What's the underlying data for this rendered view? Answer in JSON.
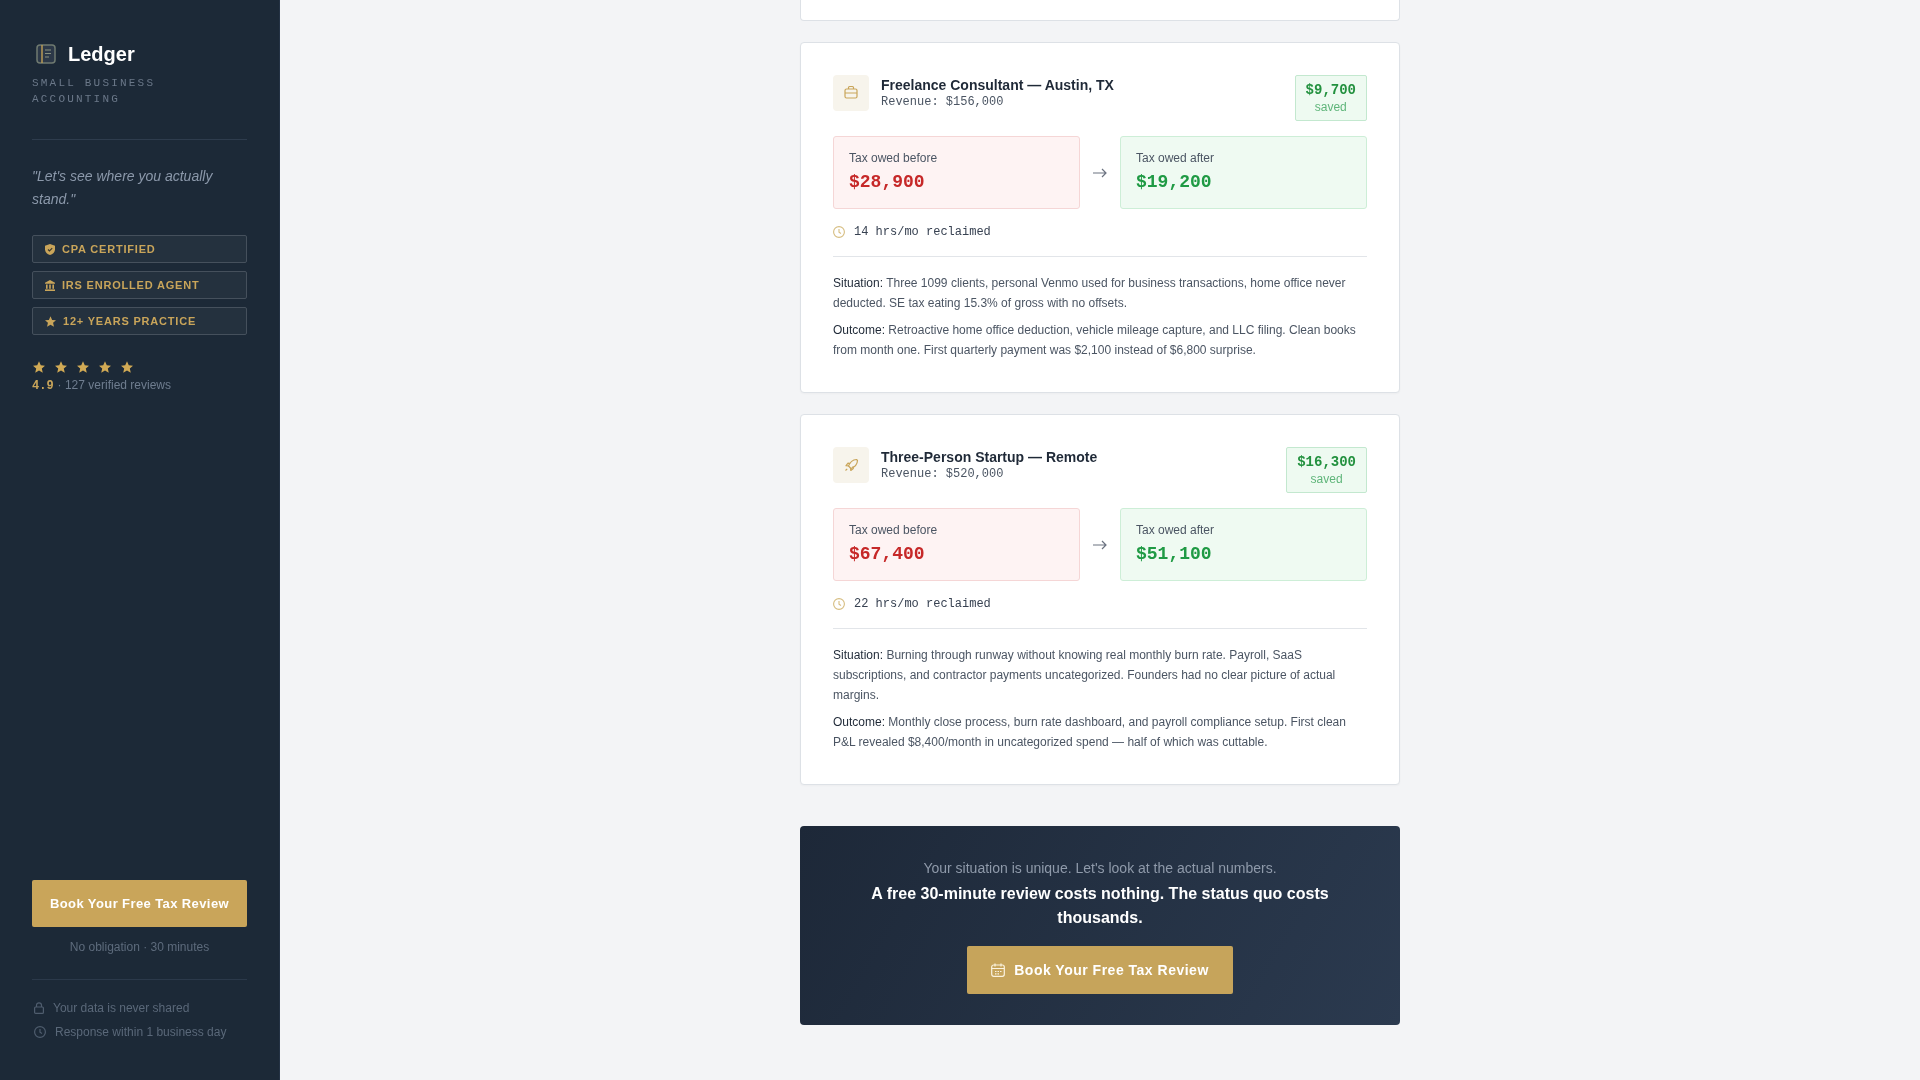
{
  "sidebar": {
    "brand": {
      "name": "Ledger",
      "tagline": "SMALL BUSINESS ACCOUNTING"
    },
    "quote": "\"Let's see where you actually stand.\"",
    "credentials": [
      {
        "kind": "shield",
        "label": "CPA CERTIFIED"
      },
      {
        "kind": "bank",
        "label": "IRS ENROLLED AGENT"
      },
      {
        "kind": "star",
        "label": "12+ YEARS PRACTICE"
      }
    ],
    "rating": {
      "stars": 5,
      "score": "4.9",
      "reviews": "· 127 verified reviews"
    },
    "button": "Book Your Free Tax Review",
    "note": "No obligation · 30 minutes",
    "trust": [
      {
        "kind": "lock",
        "text": "Your data is never shared"
      },
      {
        "kind": "clock",
        "text": "Response within 1 business day"
      }
    ]
  },
  "case_studies": [
    {
      "kind": "briefcase",
      "title": "Freelance Consultant — Austin, TX",
      "revenue": "Revenue: $156,000",
      "saved": "$9,700",
      "saved_label": "saved",
      "before_label": "Tax owed before",
      "before": "$28,900",
      "after_label": "Tax owed after",
      "after": "$19,200",
      "hours": "14 hrs/mo reclaimed",
      "notes": [
        {
          "label": "Situation:",
          "text": "Three 1099 clients, personal Venmo used for business transactions, home office never deducted. SE tax eating 15.3% of gross with no offsets."
        },
        {
          "label": "Outcome:",
          "text": "Retroactive home office deduction, vehicle mileage capture, and LLC filing. Clean books from month one. First quarterly payment was $2,100 instead of $6,800 surprise."
        }
      ]
    },
    {
      "kind": "rocket",
      "title": "Three-Person Startup — Remote",
      "revenue": "Revenue: $520,000",
      "saved": "$16,300",
      "saved_label": "saved",
      "before_label": "Tax owed before",
      "before": "$67,400",
      "after_label": "Tax owed after",
      "after": "$51,100",
      "hours": "22 hrs/mo reclaimed",
      "notes": [
        {
          "label": "Situation:",
          "text": "Burning through runway without knowing real monthly burn rate. Payroll, SaaS subscriptions, and contractor payments uncategorized. Founders had no clear picture of actual margins."
        },
        {
          "label": "Outcome:",
          "text": "Monthly close process, burn rate dashboard, and payroll compliance setup. First clean P&L revealed $8,400/month in uncategorized spend — half of which was cuttable."
        }
      ]
    }
  ],
  "cta": {
    "subtitle": "Your situation is unique. Let's look at the actual numbers.",
    "heading": "A free 30-minute review costs nothing. The status quo costs thousands.",
    "button": "Book Your Free Tax Review"
  }
}
